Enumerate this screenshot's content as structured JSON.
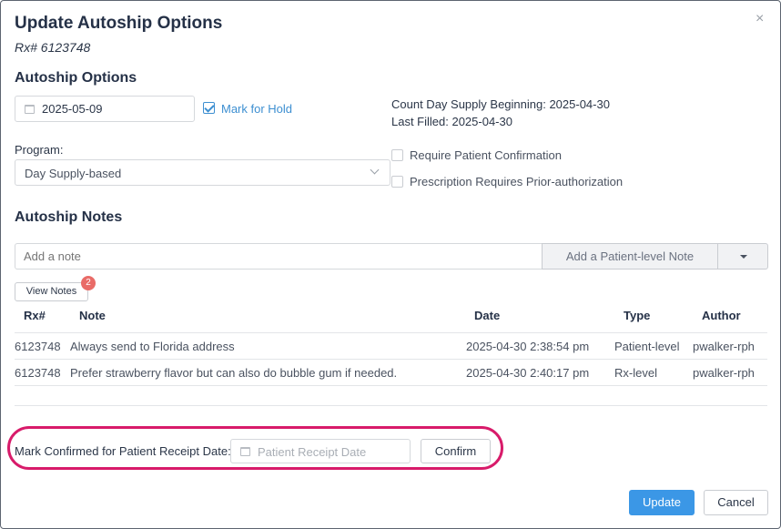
{
  "dialog": {
    "title": "Update Autoship Options",
    "subtitle": "Rx# 6123748",
    "close_glyph": "×"
  },
  "autoship_options": {
    "heading": "Autoship Options",
    "date_value": "2025-05-09",
    "mark_for_hold_label": "Mark for Hold",
    "mark_for_hold_checked": true,
    "count_day_supply": "Count Day Supply Beginning: 2025-04-30",
    "last_filled": "Last Filled: 2025-04-30",
    "program_label": "Program:",
    "program_value": "Day Supply-based",
    "require_patient_confirmation_label": "Require Patient Confirmation",
    "require_patient_confirmation_checked": false,
    "prior_auth_label": "Prescription Requires Prior-authorization",
    "prior_auth_checked": false
  },
  "notes": {
    "heading": "Autoship Notes",
    "add_placeholder": "Add a note",
    "add_button_label": "Add a Patient-level Note",
    "view_notes_label": "View Notes",
    "count_badge": "2",
    "columns": [
      "Rx#",
      "Note",
      "Date",
      "Type",
      "Author"
    ],
    "rows": [
      {
        "rx": "6123748",
        "note": "Always send to Florida address",
        "date": "2025-04-30 2:38:54 pm",
        "type": "Patient-level",
        "author": "pwalker-rph"
      },
      {
        "rx": "6123748",
        "note": "Prefer strawberry flavor but can also do bubble gum if needed.",
        "date": "2025-04-30 2:40:17 pm",
        "type": "Rx-level",
        "author": "pwalker-rph"
      }
    ]
  },
  "receipt": {
    "label": "Mark Confirmed for Patient Receipt Date:",
    "placeholder": "Patient Receipt Date",
    "confirm_label": "Confirm"
  },
  "footer": {
    "update_label": "Update",
    "cancel_label": "Cancel"
  },
  "colors": {
    "accent": "#3b97e6",
    "highlight_ring": "#d81b6a",
    "badge": "#e96b67"
  }
}
